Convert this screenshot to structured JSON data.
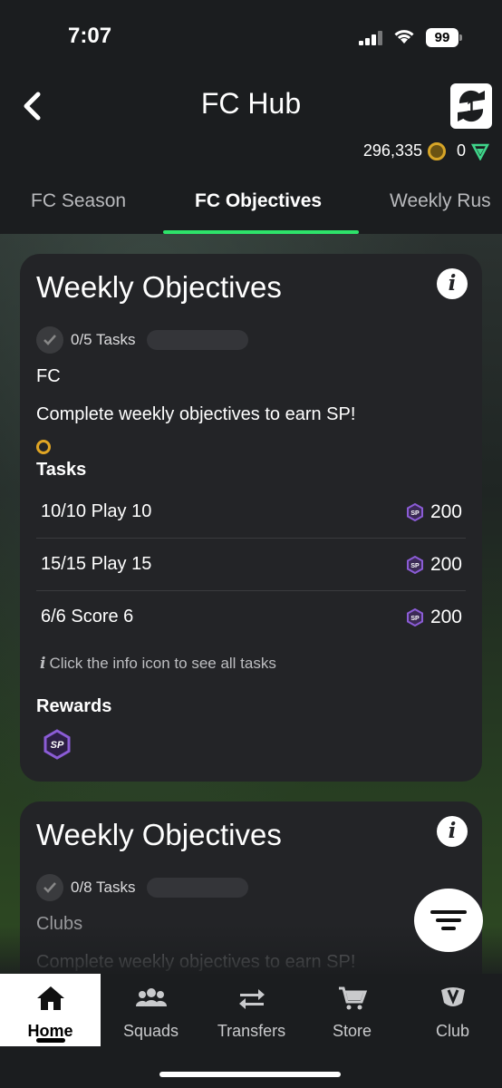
{
  "status_bar": {
    "time": "7:07",
    "battery": "99"
  },
  "header": {
    "title": "FC Hub",
    "coins": "296,335",
    "points": "0"
  },
  "tabs": [
    {
      "label": "FC Season"
    },
    {
      "label": "FC Objectives"
    },
    {
      "label": "Weekly Rus"
    }
  ],
  "card1": {
    "title": "Weekly Objectives",
    "progress_label": "0/5 Tasks",
    "group_name": "FC",
    "description": "Complete weekly objectives to earn SP!",
    "tasks_heading": "Tasks",
    "tasks": [
      {
        "name": "10/10  Play 10",
        "reward": "200"
      },
      {
        "name": "15/15  Play 15",
        "reward": "200"
      },
      {
        "name": "6/6  Score 6",
        "reward": "200"
      }
    ],
    "hint": "Click the info icon to see all tasks",
    "rewards_heading": "Rewards",
    "reward_icon": "SP"
  },
  "card2": {
    "title": "Weekly Objectives",
    "progress_label": "0/8 Tasks",
    "group_name": "Clubs",
    "description": "Complete weekly objectives to earn SP!"
  },
  "nav": [
    {
      "label": "Home",
      "icon": "home-icon"
    },
    {
      "label": "Squads",
      "icon": "squads-icon"
    },
    {
      "label": "Transfers",
      "icon": "transfers-icon"
    },
    {
      "label": "Store",
      "icon": "store-icon"
    },
    {
      "label": "Club",
      "icon": "club-icon"
    }
  ],
  "colors": {
    "accent": "#2ee36a",
    "card": "#232427",
    "coin": "#d7a527",
    "sp": "#8b5cd6"
  }
}
